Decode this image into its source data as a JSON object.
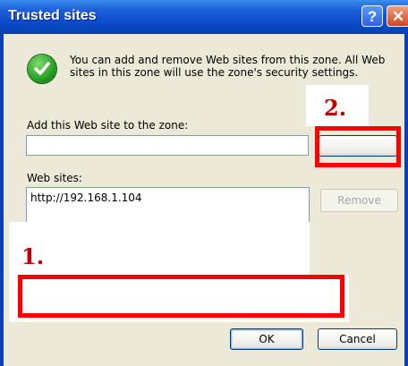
{
  "window": {
    "title": "Trusted sites",
    "help_glyph": "?",
    "close_glyph": "✕"
  },
  "info": {
    "icon": "check-icon",
    "text": "You can add and remove Web sites from this zone. All Web sites in this zone will use the zone's security settings."
  },
  "add_site": {
    "label": "Add this Web site to the zone:",
    "value": "",
    "add_button": ""
  },
  "websites": {
    "label": "Web sites:",
    "items": [
      "http://192.168.1.104"
    ],
    "remove_button": "Remove"
  },
  "footer": {
    "ok_button": "OK",
    "cancel_button": "Cancel"
  },
  "annotations": {
    "marker_1": "1.",
    "marker_2": "2.",
    "color": "#ff0000"
  }
}
